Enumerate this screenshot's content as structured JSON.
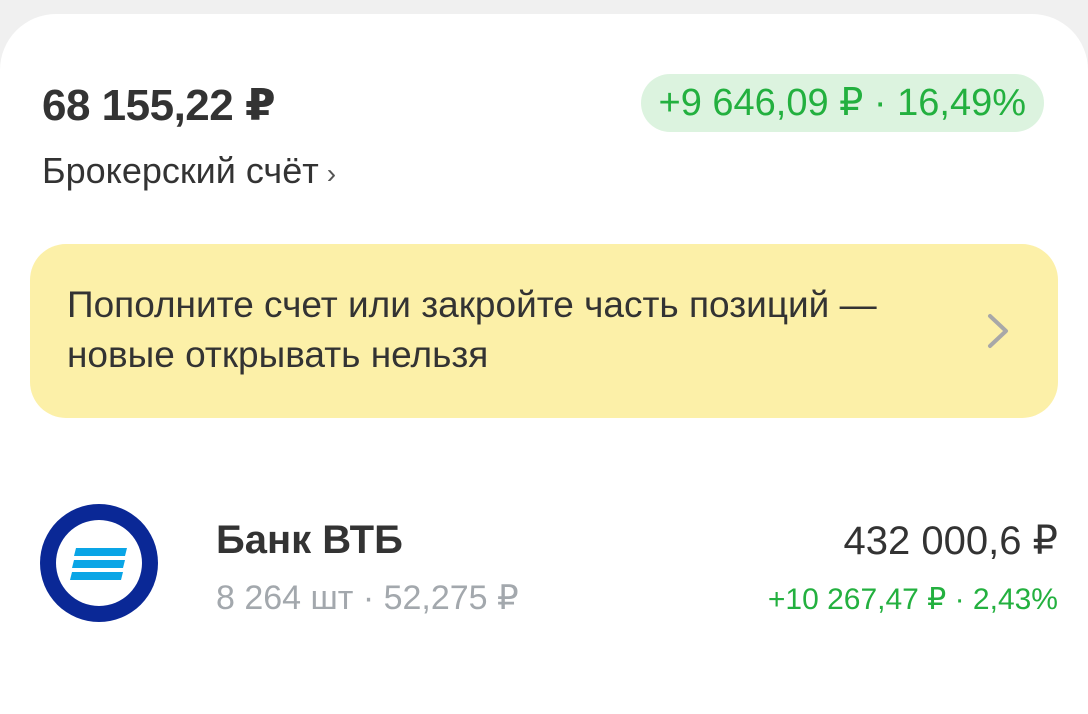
{
  "portfolio": {
    "balance": "68 155,22 ₽",
    "profit": "+9 646,09 ₽ · 16,49%",
    "account_label": "Брокерский счёт",
    "account_chevron": "›"
  },
  "warning": {
    "text": "Пополните счет или закройте часть позиций — новые открывать нельзя",
    "icon": "chevron-right-icon"
  },
  "positions": [
    {
      "name": "Банк ВТБ",
      "meta": "8 264 шт · 52,275 ₽",
      "value": "432 000,6 ₽",
      "profit": "+10 267,47 ₽ · 2,43%",
      "logo_icon": "vtb-logo-icon"
    }
  ],
  "colors": {
    "profit_green": "#23b03f",
    "profit_bg": "#dcf3df",
    "warning_bg": "#fcf0a8",
    "vtb_dark_blue": "#0a2896",
    "vtb_light_blue": "#0aa5e6"
  }
}
